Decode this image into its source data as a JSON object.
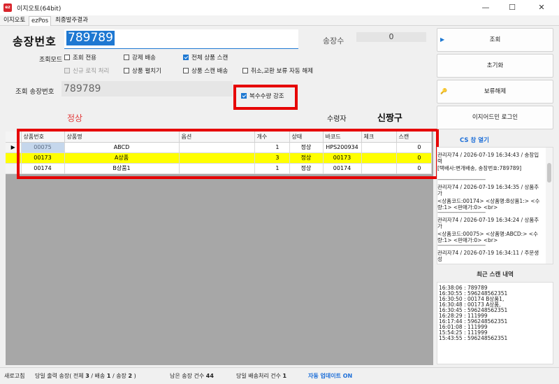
{
  "window": {
    "title": "이지오토(64bit)",
    "icon_text": "ez",
    "minimize_glyph": "—",
    "maximize_glyph": "☐",
    "close_glyph": "✕"
  },
  "menu_tabs": [
    "이지오토",
    "ezPos",
    "최종발주결과"
  ],
  "invoice": {
    "label": "송장번호",
    "value": "789789",
    "count_label": "송장수",
    "count_value": "0"
  },
  "lookup_mode": {
    "label": "조회모드",
    "options": [
      {
        "label": "조회 전용",
        "checked": false,
        "disabled": false
      },
      {
        "label": "강제 배송",
        "checked": false,
        "disabled": false
      },
      {
        "label": "전체 상품 스캔",
        "checked": true,
        "disabled": false
      },
      {
        "label": "신규 로직 처리",
        "checked": true,
        "disabled": true
      },
      {
        "label": "상품 펼치기",
        "checked": false,
        "disabled": false
      },
      {
        "label": "상품 스캔 배송",
        "checked": false,
        "disabled": false
      },
      {
        "label": "취소,교환 보류 자동 해제",
        "checked": false,
        "disabled": false
      }
    ]
  },
  "lookup_invoice": {
    "label": "조회 송장번호",
    "value": "789789"
  },
  "multi_qty": {
    "label": "복수수량 강조",
    "checked": true
  },
  "order_status": "정상",
  "receiver": {
    "label": "수령자",
    "name": "신짱구"
  },
  "grid": {
    "columns": [
      "상품번호",
      "상품명",
      "옵션",
      "개수",
      "상태",
      "바코드",
      "체크",
      "스캔"
    ],
    "current_row_marker": "▶",
    "rows": [
      {
        "product_no": "00075",
        "name": "ABCD",
        "option": "",
        "qty": "1",
        "status": "정상",
        "barcode": "HPS200934",
        "check": "",
        "scan": "0",
        "highlight": false
      },
      {
        "product_no": "00173",
        "name": "A상품",
        "option": "",
        "qty": "3",
        "status": "정상",
        "barcode": "00173",
        "check": "",
        "scan": "0",
        "highlight": true
      },
      {
        "product_no": "00174",
        "name": "B상품1",
        "option": "",
        "qty": "1",
        "status": "정상",
        "barcode": "00174",
        "check": "",
        "scan": "0",
        "highlight": false
      }
    ]
  },
  "buttons": {
    "search": "조회",
    "reset": "초기화",
    "release_hold": "보류해제",
    "admin_login": "이지어드민 로그인",
    "search_icon": "▶",
    "key_icon": "🔑"
  },
  "cs_window_link": "CS 창 열기",
  "logs": [
    "관리자74 / 2026-07-19 16:34:43 / 송장입력",
    "[택배사:변개배송, 송장번호:789789]",
    "관리자74 / 2026-07-19 16:34:35 / 상품추가",
    "<상품코드:00174> <상품명:B상품1:> <수량:1> <판매가:0> <br>",
    "관리자74 / 2026-07-19 16:34:24 / 상품추가",
    "<상품코드:00075> <상품명:ABCD:> <수량:1> <판매가:0> <br>",
    "관리자74 / 2026-07-19 16:34:11 / 주문생성"
  ],
  "log_separator": "----------------------------------------",
  "recent_scans": {
    "title": "최근 스캔 내역",
    "lines": [
      "16:38:06 :  789789",
      "16:30:55 :  596248562351",
      "16:30:50 :  00174 B상품1,",
      "16:30:48 :  00173 A상품,",
      "16:30:45 :  596248562351",
      "16:28:29 :  111999",
      "16:17:44 :  596248562351",
      "16:01:08 :  111999",
      "15:54:25 :  111999",
      "15:43:55 :  596248562351"
    ]
  },
  "statusbar": {
    "refresh": "새로고침",
    "daily_output_label": "당일 출력 송장( 전체",
    "total": "3",
    "delivery_label": "/ 배송",
    "delivery": "1",
    "invoice_label": "/ 송장",
    "invoice": "2",
    "close_paren": ")",
    "remaining_label": "남은 송장 건수",
    "remaining": "44",
    "daily_delivery_label": "당일 배송처리 건수",
    "daily_delivery": "1",
    "auto_update": "자동 업데이트 ON"
  }
}
